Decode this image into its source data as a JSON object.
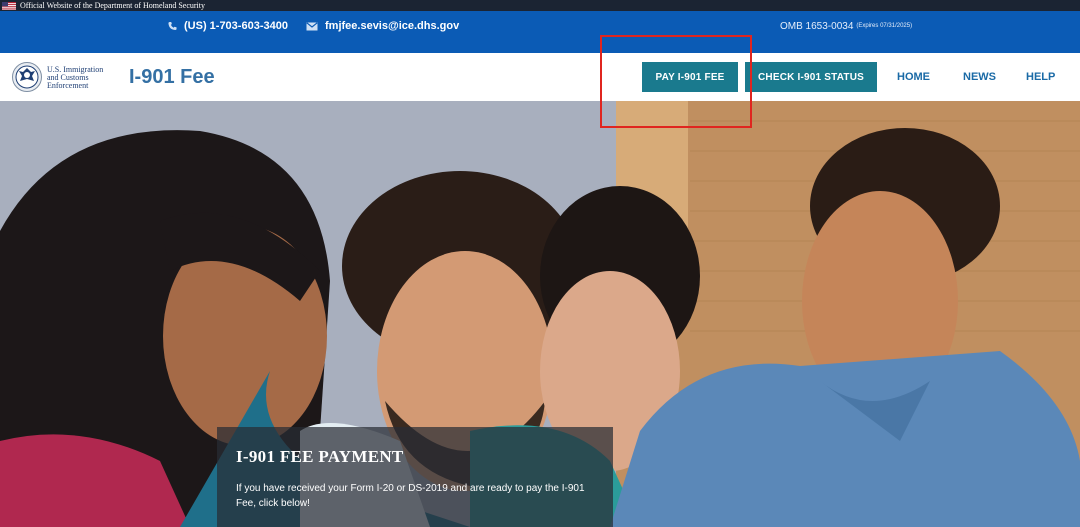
{
  "banner": {
    "text": "Official Website of the Department of Homeland Security"
  },
  "contact": {
    "phone": "(US) 1-703-603-3400",
    "email": "fmjfee.sevis@ice.dhs.gov",
    "omb": "OMB 1653-0034",
    "omb_expires": "(Expires 07/31/2025)"
  },
  "header": {
    "agency_line1": "U.S. Immigration",
    "agency_line2": "and Customs",
    "agency_line3": "Enforcement",
    "site_title": "I-901 Fee",
    "nav": {
      "pay": "PAY I-901 FEE",
      "check": "CHECK I-901 STATUS",
      "home": "HOME",
      "news": "NEWS",
      "help": "HELP"
    }
  },
  "hero": {
    "title": "I-901 FEE PAYMENT",
    "text": "If you have received your Form I-20 or DS-2019 and are ready to pay the I-901 Fee, click below!"
  },
  "icons": {
    "phone": "phone-icon",
    "email": "envelope-icon",
    "flag": "us-flag-icon",
    "seal": "dhs-seal-icon"
  },
  "colors": {
    "banner": "#1b2433",
    "contact_bar": "#0b5bb5",
    "nav_button": "#1a7a8e",
    "nav_link": "#1a6aa6",
    "highlight": "#e0251f"
  }
}
